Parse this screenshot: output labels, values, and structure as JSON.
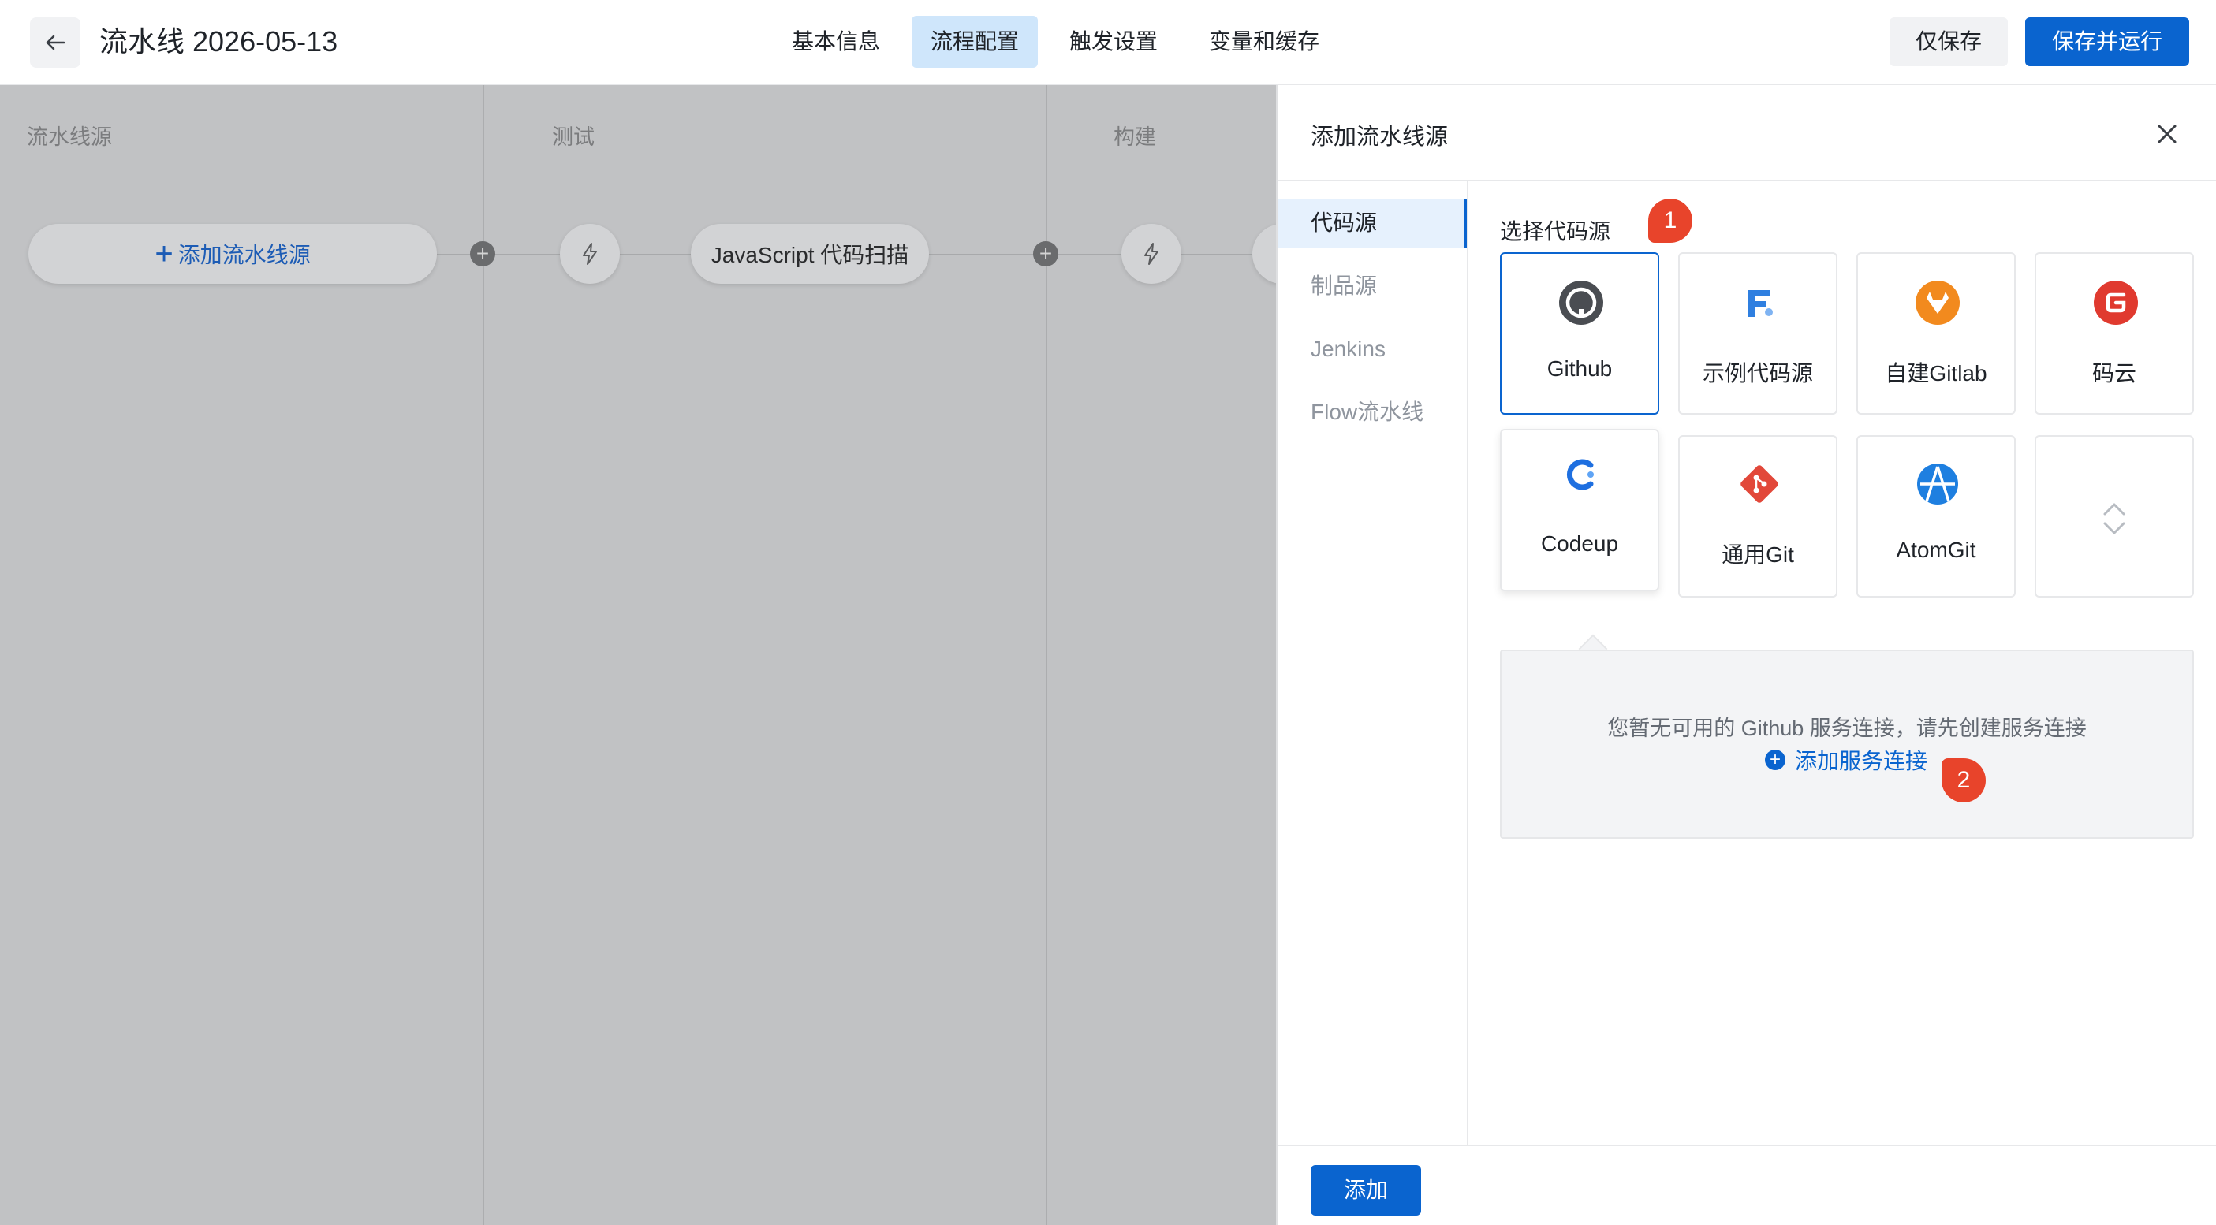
{
  "header": {
    "title": "流水线 2026-05-13",
    "tabs": [
      {
        "label": "基本信息"
      },
      {
        "label": "流程配置"
      },
      {
        "label": "触发设置"
      },
      {
        "label": "变量和缓存"
      }
    ],
    "save_label": "仅保存",
    "save_run_label": "保存并运行"
  },
  "canvas": {
    "stages": [
      "流水线源",
      "测试",
      "构建"
    ],
    "add_source_label": "添加流水线源",
    "job_label": "JavaScript 代码扫描"
  },
  "drawer": {
    "title": "添加流水线源",
    "menu": [
      "代码源",
      "制品源",
      "Jenkins",
      "Flow流水线"
    ],
    "section_label": "选择代码源",
    "sources": [
      {
        "label": "Github",
        "icon": "github-icon"
      },
      {
        "label": "示例代码源",
        "icon": "sample-source-icon"
      },
      {
        "label": "自建Gitlab",
        "icon": "gitlab-icon"
      },
      {
        "label": "码云",
        "icon": "gitee-icon"
      },
      {
        "label": "Codeup",
        "icon": "codeup-icon"
      },
      {
        "label": "通用Git",
        "icon": "git-icon"
      },
      {
        "label": "AtomGit",
        "icon": "atomgit-icon"
      }
    ],
    "empty_text": "您暂无可用的 Github 服务连接，请先创建服务连接",
    "add_connection_label": "添加服务连接",
    "add_button": "添加",
    "badges": [
      "1",
      "2"
    ]
  },
  "colors": {
    "primary": "#0a64cf",
    "badge": "#e8442b",
    "tab_active": "#cfe6fb"
  }
}
